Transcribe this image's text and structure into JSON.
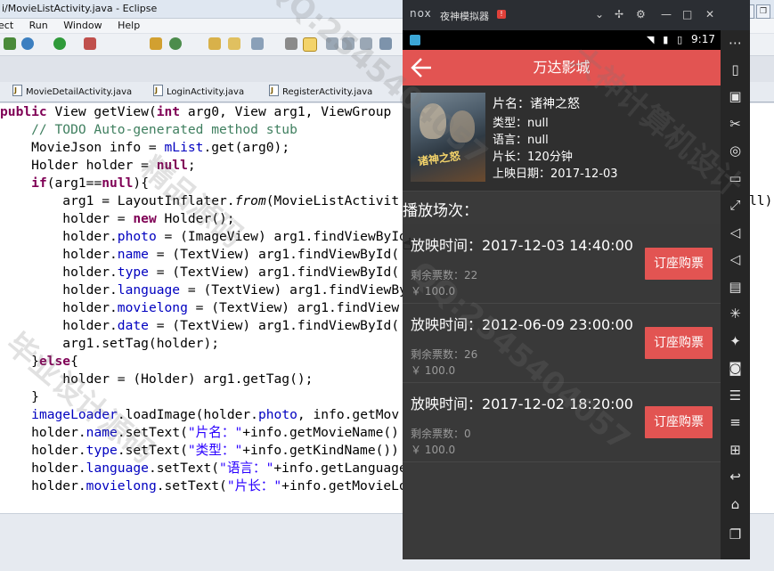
{
  "eclipse": {
    "window_title": "i/MovieListActivity.java - Eclipse",
    "menu": [
      "ect",
      "Run",
      "Window",
      "Help"
    ],
    "tabs": [
      "MovieDetailActivity.java",
      "LoginActivity.java",
      "RegisterActivity.java"
    ],
    "code_lines": [
      "public View getView(int arg0, View arg1, ViewGroup",
      "    // TODO Auto-generated method stub",
      "    MovieJson info = mList.get(arg0);",
      "    Holder holder = null;",
      "    if(arg1==null){",
      "        arg1 = LayoutInflater.from(MovieListActivit",
      "        holder = new Holder();",
      "        holder.photo = (ImageView) arg1.findViewById(",
      "        holder.name = (TextView) arg1.findViewById(",
      "        holder.type = (TextView) arg1.findViewById(",
      "        holder.language = (TextView) arg1.findViewBy",
      "        holder.movielong = (TextView) arg1.findView",
      "        holder.date = (TextView) arg1.findViewById(",
      "        arg1.setTag(holder);",
      "    }else{",
      "        holder = (Holder) arg1.getTag();",
      "    }",
      "    imageLoader.loadImage(holder.photo, info.getMov",
      "    holder.name.setText(\"片名：\"+info.getMovieName()",
      "    holder.type.setText(\"类型：\"+info.getKindName())",
      "    holder.language.setText(\"语言：\"+info.getLanguage",
      "    holder.movielong.setText(\"片长：\"+info.getMovieLo"
    ],
    "right_edge_fragment": "ll);"
  },
  "emulator": {
    "brand": "nox",
    "name": "夜神模拟器",
    "badge": "!",
    "status_time": "9:17"
  },
  "app": {
    "title": "万达影城",
    "movie": {
      "name": "片名：诸神之怒",
      "type": "类型：null",
      "language": "语言：null",
      "length": "片长：120分钟",
      "release": "上映日期：2017-12-03",
      "poster_text": "诸神之怒"
    },
    "section_title": "播放场次：",
    "showings": [
      {
        "time": "放映时间：2017-12-03 14:40:00",
        "remaining": "剩余票数：22",
        "price": "￥ 100.0",
        "button": "订座购票"
      },
      {
        "time": "放映时间：2012-06-09 23:00:00",
        "remaining": "剩余票数：26",
        "price": "￥ 100.0",
        "button": "订座购票"
      },
      {
        "time": "放映时间：2017-12-02 18:20:00",
        "remaining": "剩余票数：0",
        "price": "￥ 100.0",
        "button": "订座购票"
      }
    ]
  },
  "watermark": [
    "QQ:2545404057",
    "大神计算机设计",
    "毕业设计源码",
    "QQ:2545404057",
    "精品源码"
  ],
  "colors": {
    "accent": "#e25452",
    "keyword": "#7f0055",
    "comment": "#3f7f5f",
    "field": "#0000c0",
    "string": "#2a00ff"
  }
}
